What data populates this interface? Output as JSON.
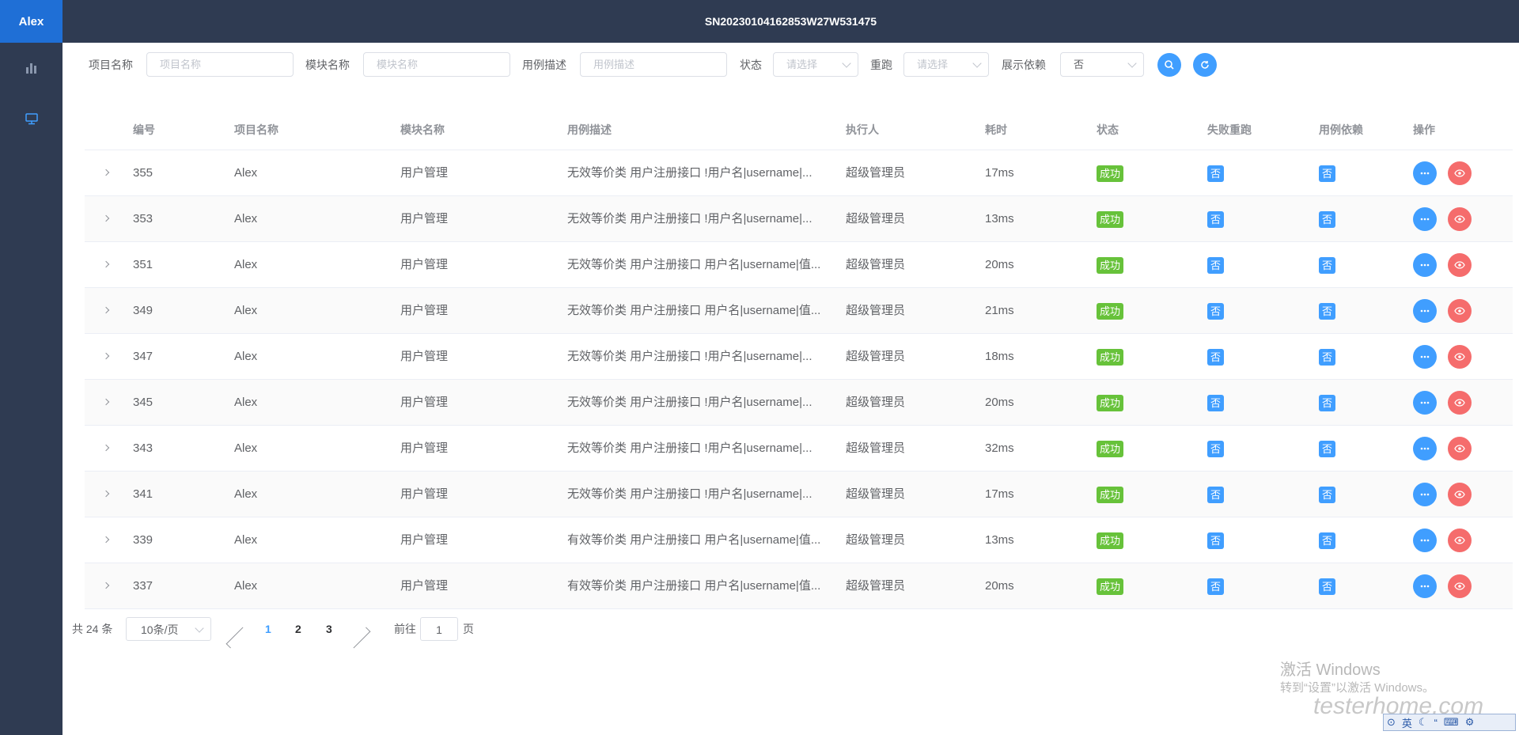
{
  "sidebar": {
    "logo": "Alex",
    "icons": [
      "bar-chart-icon",
      "monitor-icon"
    ]
  },
  "header": {
    "title": "SN20230104162853W27W531475"
  },
  "filters": {
    "project_label": "项目名称",
    "project_placeholder": "项目名称",
    "module_label": "模块名称",
    "module_placeholder": "模块名称",
    "desc_label": "用例描述",
    "desc_placeholder": "用例描述",
    "status_label": "状态",
    "status_placeholder": "请选择",
    "rerun_label": "重跑",
    "rerun_placeholder": "请选择",
    "dep_label": "展示依赖",
    "dep_value": "否"
  },
  "columns": [
    "编号",
    "项目名称",
    "模块名称",
    "用例描述",
    "执行人",
    "耗时",
    "状态",
    "失败重跑",
    "用例依赖",
    "操作"
  ],
  "rows": [
    {
      "id": "355",
      "project": "Alex",
      "module": "用户管理",
      "desc": "无效等价类 用户注册接口 !用户名|username|...",
      "executor": "超级管理员",
      "time": "17ms",
      "status": "成功",
      "rerun": "否",
      "dep": "否"
    },
    {
      "id": "353",
      "project": "Alex",
      "module": "用户管理",
      "desc": "无效等价类 用户注册接口 !用户名|username|...",
      "executor": "超级管理员",
      "time": "13ms",
      "status": "成功",
      "rerun": "否",
      "dep": "否"
    },
    {
      "id": "351",
      "project": "Alex",
      "module": "用户管理",
      "desc": "无效等价类 用户注册接口 用户名|username|值...",
      "executor": "超级管理员",
      "time": "20ms",
      "status": "成功",
      "rerun": "否",
      "dep": "否"
    },
    {
      "id": "349",
      "project": "Alex",
      "module": "用户管理",
      "desc": "无效等价类 用户注册接口 用户名|username|值...",
      "executor": "超级管理员",
      "time": "21ms",
      "status": "成功",
      "rerun": "否",
      "dep": "否"
    },
    {
      "id": "347",
      "project": "Alex",
      "module": "用户管理",
      "desc": "无效等价类 用户注册接口 !用户名|username|...",
      "executor": "超级管理员",
      "time": "18ms",
      "status": "成功",
      "rerun": "否",
      "dep": "否"
    },
    {
      "id": "345",
      "project": "Alex",
      "module": "用户管理",
      "desc": "无效等价类 用户注册接口 !用户名|username|...",
      "executor": "超级管理员",
      "time": "20ms",
      "status": "成功",
      "rerun": "否",
      "dep": "否"
    },
    {
      "id": "343",
      "project": "Alex",
      "module": "用户管理",
      "desc": "无效等价类 用户注册接口 !用户名|username|...",
      "executor": "超级管理员",
      "time": "32ms",
      "status": "成功",
      "rerun": "否",
      "dep": "否"
    },
    {
      "id": "341",
      "project": "Alex",
      "module": "用户管理",
      "desc": "无效等价类 用户注册接口 !用户名|username|...",
      "executor": "超级管理员",
      "time": "17ms",
      "status": "成功",
      "rerun": "否",
      "dep": "否"
    },
    {
      "id": "339",
      "project": "Alex",
      "module": "用户管理",
      "desc": "有效等价类 用户注册接口 用户名|username|值...",
      "executor": "超级管理员",
      "time": "13ms",
      "status": "成功",
      "rerun": "否",
      "dep": "否"
    },
    {
      "id": "337",
      "project": "Alex",
      "module": "用户管理",
      "desc": "有效等价类 用户注册接口 用户名|username|值...",
      "executor": "超级管理员",
      "time": "20ms",
      "status": "成功",
      "rerun": "否",
      "dep": "否"
    }
  ],
  "pagination": {
    "total": "共 24 条",
    "page_size": "10条/页",
    "pages": [
      "1",
      "2",
      "3"
    ],
    "current": "1",
    "goto_label": "前往",
    "goto_value": "1",
    "goto_suffix": "页"
  },
  "watermark": {
    "activate_title": "激活 Windows",
    "activate_sub": "转到“设置”以激活 Windows。",
    "site": "testerhome.com"
  },
  "ime": {
    "lang": "英"
  },
  "colors": {
    "sidebar": "#2f3b52",
    "logo": "#1f6fd6",
    "primary": "#409eff",
    "success": "#67c23a",
    "danger": "#f56c6c"
  }
}
